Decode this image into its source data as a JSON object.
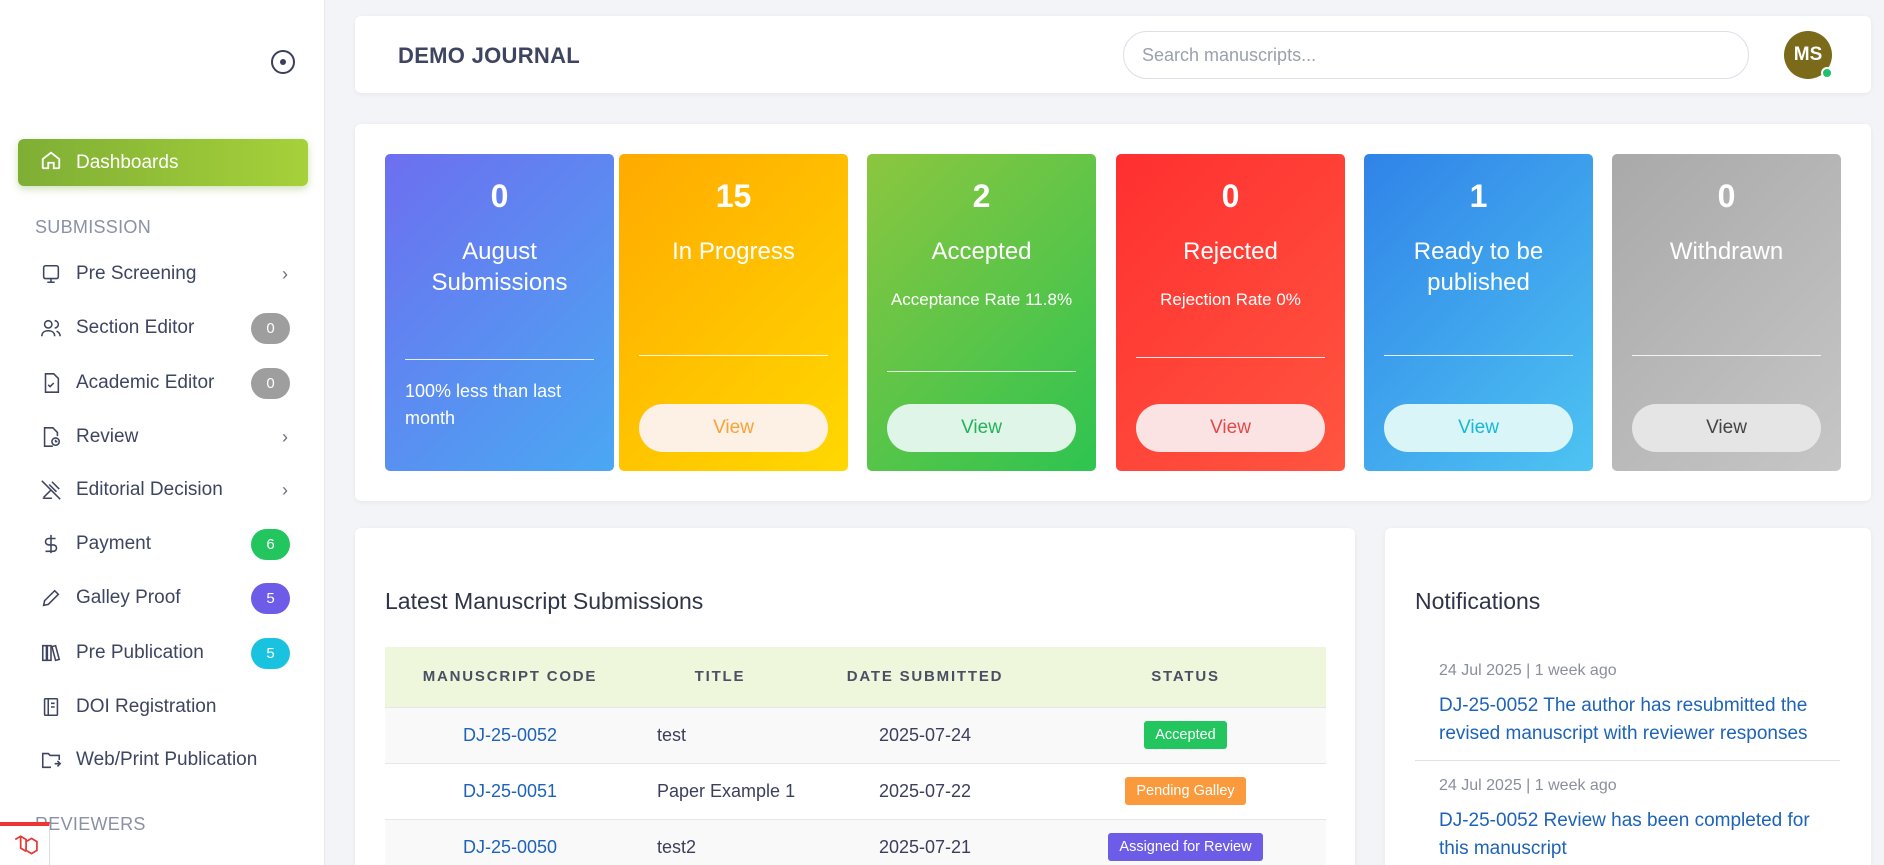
{
  "sidebar": {
    "active": {
      "label": "Dashboards",
      "icon": "home-icon"
    },
    "section_submission": "SUBMISSION",
    "items": [
      {
        "label": "Pre Screening",
        "icon": "monitor-icon",
        "chevron": true
      },
      {
        "label": "Section Editor",
        "icon": "users-icon",
        "badge": "0",
        "badge_color": "#9e9e9e"
      },
      {
        "label": "Academic Editor",
        "icon": "file-check-icon",
        "badge": "0",
        "badge_color": "#9e9e9e"
      },
      {
        "label": "Review",
        "icon": "file-clock-icon",
        "chevron": true
      },
      {
        "label": "Editorial Decision",
        "icon": "gavel-icon",
        "chevron": true
      },
      {
        "label": "Payment",
        "icon": "dollar-icon",
        "badge": "6",
        "badge_color": "#22c55e"
      },
      {
        "label": "Galley Proof",
        "icon": "pencil-icon",
        "badge": "5",
        "badge_color": "#6c5ce7"
      },
      {
        "label": "Pre Publication",
        "icon": "books-icon",
        "badge": "5",
        "badge_color": "#19c3e0"
      },
      {
        "label": "DOI Registration",
        "icon": "book-icon"
      },
      {
        "label": "Web/Print Publication",
        "icon": "folder-share-icon"
      }
    ],
    "section_reviewers": "REVIEWERS"
  },
  "header": {
    "journal_title": "DEMO JOURNAL",
    "search_placeholder": "Search manuscripts...",
    "avatar_initials": "MS"
  },
  "stats": [
    {
      "value": "0",
      "label": "August Submissions",
      "note": "100% less than last month",
      "colors": [
        "#6d6ff0",
        "#4aa8f2"
      ]
    },
    {
      "value": "15",
      "label": "In Progress",
      "button": "View",
      "colors": [
        "#ffaa00",
        "#ffd800"
      ],
      "btn_bg": "#fdf0e4",
      "btn_color": "#f7a33a"
    },
    {
      "value": "2",
      "label": "Accepted",
      "sub": "Acceptance Rate 11.8%",
      "button": "View",
      "colors": [
        "#8cc63f",
        "#2ec451"
      ],
      "btn_bg": "#dff5e7",
      "btn_color": "#22b35a"
    },
    {
      "value": "0",
      "label": "Rejected",
      "sub": "Rejection Rate 0%",
      "button": "View",
      "colors": [
        "#ff3030",
        "#ff5540"
      ],
      "btn_bg": "#fbe3e3",
      "btn_color": "#e24a4a"
    },
    {
      "value": "1",
      "label": "Ready to be published",
      "button": "View",
      "colors": [
        "#3083e8",
        "#4ec4f2"
      ],
      "btn_bg": "#d9f5f8",
      "btn_color": "#17b8d4"
    },
    {
      "value": "0",
      "label": "Withdrawn",
      "button": "View",
      "colors": [
        "#a9a9a9",
        "#c6c6c6"
      ],
      "btn_bg": "#e5e5e5",
      "btn_color": "#444444"
    }
  ],
  "manuscripts": {
    "title": "Latest Manuscript Submissions",
    "columns": [
      "MANUSCRIPT CODE",
      "TITLE",
      "DATE SUBMITTED",
      "STATUS"
    ],
    "rows": [
      {
        "code": "DJ-25-0052",
        "title": "test",
        "date": "2025-07-24",
        "status": "Accepted",
        "status_color": "#22c55e"
      },
      {
        "code": "DJ-25-0051",
        "title": "Paper Example 1",
        "date": "2025-07-22",
        "status": "Pending Galley",
        "status_color": "#fb9a3c"
      },
      {
        "code": "DJ-25-0050",
        "title": "test2",
        "date": "2025-07-21",
        "status": "Assigned for Review",
        "status_color": "#6c5ce7"
      }
    ]
  },
  "notifications": {
    "title": "Notifications",
    "items": [
      {
        "meta": "24 Jul 2025 | 1 week ago",
        "text": "DJ-25-0052 The author has resubmitted the revised manuscript with reviewer responses"
      },
      {
        "meta": "24 Jul 2025 | 1 week ago",
        "text": "DJ-25-0052 Review has been completed for this manuscript"
      }
    ]
  }
}
